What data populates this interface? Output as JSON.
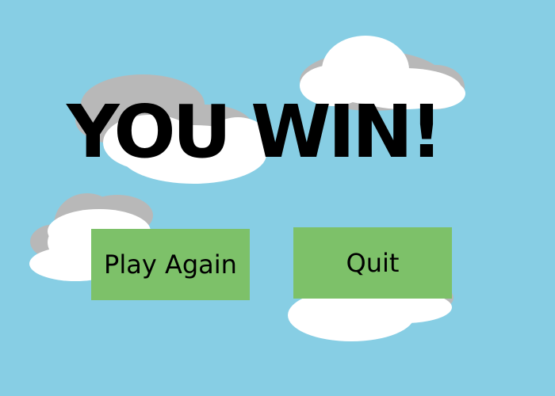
{
  "screen": {
    "title": "YOU WIN!",
    "background_color": "#87CEE4"
  },
  "buttons": {
    "play_again_label": "Play Again",
    "quit_label": "Quit",
    "color": "#7DC169"
  },
  "clouds": {
    "fill_color": "#FFFFFF",
    "shadow_color": "#B8B8B8"
  }
}
